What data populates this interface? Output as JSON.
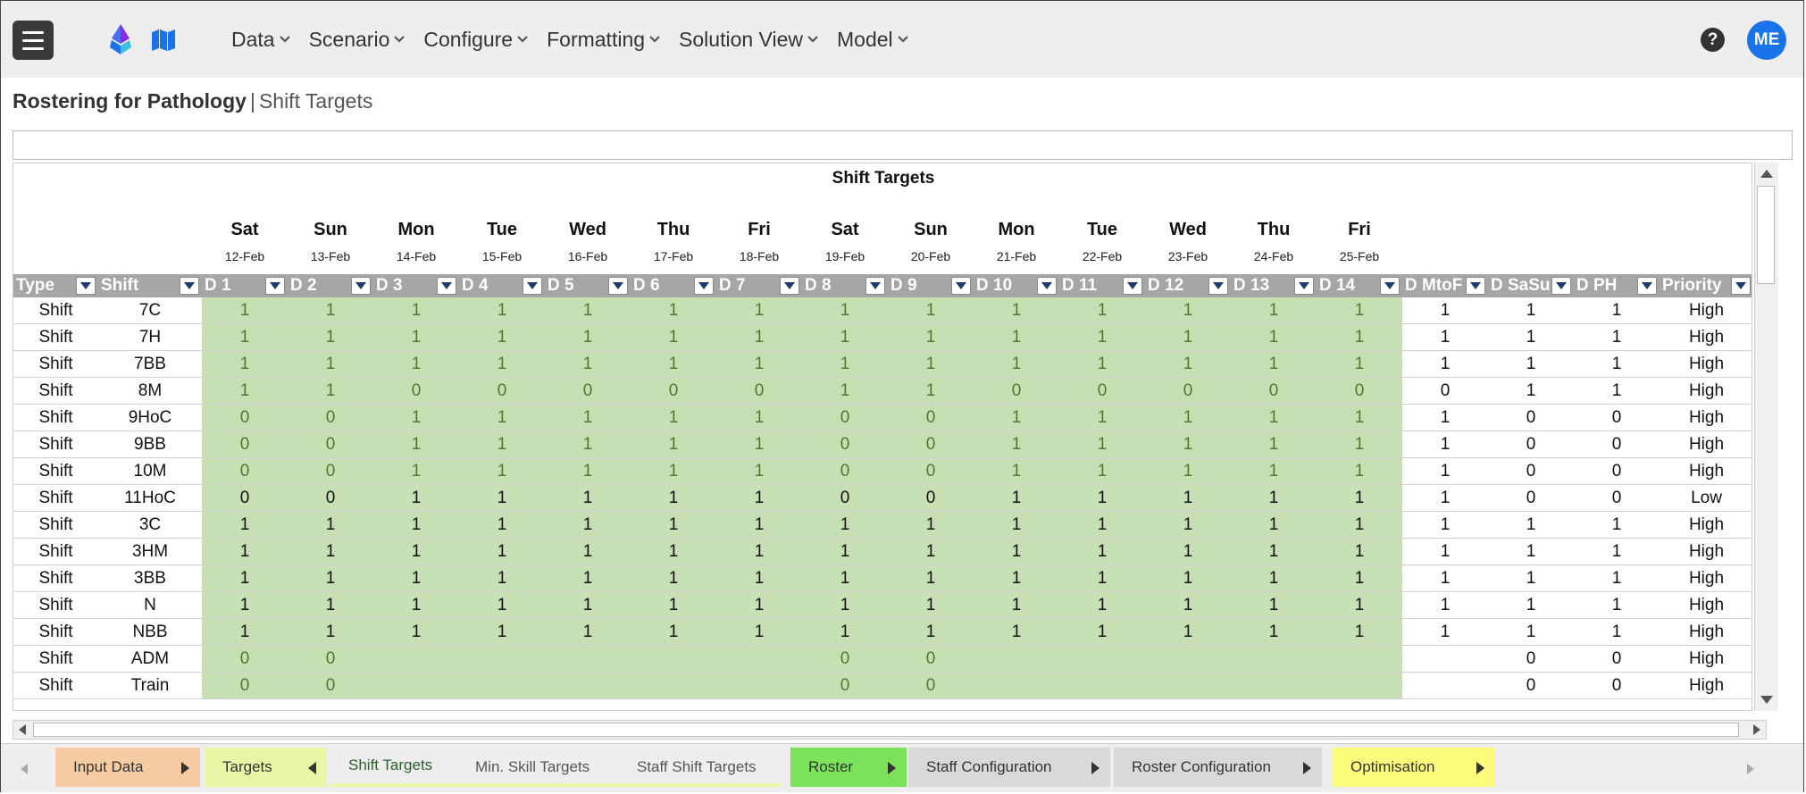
{
  "menu": [
    "Data",
    "Scenario",
    "Configure",
    "Formatting",
    "Solution View",
    "Model"
  ],
  "user_initials": "ME",
  "help_label": "?",
  "title": {
    "app": "Rostering for Pathology",
    "separator": "|",
    "page": "Shift Targets"
  },
  "sheet": {
    "title": "Shift Targets",
    "days": [
      {
        "day": "Sat",
        "date": "12-Feb"
      },
      {
        "day": "Sun",
        "date": "13-Feb"
      },
      {
        "day": "Mon",
        "date": "14-Feb"
      },
      {
        "day": "Tue",
        "date": "15-Feb"
      },
      {
        "day": "Wed",
        "date": "16-Feb"
      },
      {
        "day": "Thu",
        "date": "17-Feb"
      },
      {
        "day": "Fri",
        "date": "18-Feb"
      },
      {
        "day": "Sat",
        "date": "19-Feb"
      },
      {
        "day": "Sun",
        "date": "20-Feb"
      },
      {
        "day": "Mon",
        "date": "21-Feb"
      },
      {
        "day": "Tue",
        "date": "22-Feb"
      },
      {
        "day": "Wed",
        "date": "23-Feb"
      },
      {
        "day": "Thu",
        "date": "24-Feb"
      },
      {
        "day": "Fri",
        "date": "25-Feb"
      }
    ],
    "columns": [
      "Type",
      "Shift",
      "D 1",
      "D 2",
      "D 3",
      "D 4",
      "D 5",
      "D 6",
      "D 7",
      "D 8",
      "D 9",
      "D 10",
      "D 11",
      "D 12",
      "D 13",
      "D 14",
      "D MtoF",
      "D SaSu",
      "D PH",
      "Priority"
    ],
    "rows": [
      {
        "type": "Shift",
        "shift": "7C",
        "d": [
          "1",
          "1",
          "1",
          "1",
          "1",
          "1",
          "1",
          "1",
          "1",
          "1",
          "1",
          "1",
          "1",
          "1"
        ],
        "mtof": "1",
        "sasu": "1",
        "ph": "1",
        "priority": "High",
        "style": "g"
      },
      {
        "type": "Shift",
        "shift": "7H",
        "d": [
          "1",
          "1",
          "1",
          "1",
          "1",
          "1",
          "1",
          "1",
          "1",
          "1",
          "1",
          "1",
          "1",
          "1"
        ],
        "mtof": "1",
        "sasu": "1",
        "ph": "1",
        "priority": "High",
        "style": "g"
      },
      {
        "type": "Shift",
        "shift": "7BB",
        "d": [
          "1",
          "1",
          "1",
          "1",
          "1",
          "1",
          "1",
          "1",
          "1",
          "1",
          "1",
          "1",
          "1",
          "1"
        ],
        "mtof": "1",
        "sasu": "1",
        "ph": "1",
        "priority": "High",
        "style": "g"
      },
      {
        "type": "Shift",
        "shift": "8M",
        "d": [
          "1",
          "1",
          "0",
          "0",
          "0",
          "0",
          "0",
          "1",
          "1",
          "0",
          "0",
          "0",
          "0",
          "0"
        ],
        "mtof": "0",
        "sasu": "1",
        "ph": "1",
        "priority": "High",
        "style": "g"
      },
      {
        "type": "Shift",
        "shift": "9HoC",
        "d": [
          "0",
          "0",
          "1",
          "1",
          "1",
          "1",
          "1",
          "0",
          "0",
          "1",
          "1",
          "1",
          "1",
          "1"
        ],
        "mtof": "1",
        "sasu": "0",
        "ph": "0",
        "priority": "High",
        "style": "g"
      },
      {
        "type": "Shift",
        "shift": "9BB",
        "d": [
          "0",
          "0",
          "1",
          "1",
          "1",
          "1",
          "1",
          "0",
          "0",
          "1",
          "1",
          "1",
          "1",
          "1"
        ],
        "mtof": "1",
        "sasu": "0",
        "ph": "0",
        "priority": "High",
        "style": "g"
      },
      {
        "type": "Shift",
        "shift": "10M",
        "d": [
          "0",
          "0",
          "1",
          "1",
          "1",
          "1",
          "1",
          "0",
          "0",
          "1",
          "1",
          "1",
          "1",
          "1"
        ],
        "mtof": "1",
        "sasu": "0",
        "ph": "0",
        "priority": "High",
        "style": "g"
      },
      {
        "type": "Shift",
        "shift": "11HoC",
        "d": [
          "0",
          "0",
          "1",
          "1",
          "1",
          "1",
          "1",
          "0",
          "0",
          "1",
          "1",
          "1",
          "1",
          "1"
        ],
        "mtof": "1",
        "sasu": "0",
        "ph": "0",
        "priority": "Low",
        "style": "b"
      },
      {
        "type": "Shift",
        "shift": "3C",
        "d": [
          "1",
          "1",
          "1",
          "1",
          "1",
          "1",
          "1",
          "1",
          "1",
          "1",
          "1",
          "1",
          "1",
          "1"
        ],
        "mtof": "1",
        "sasu": "1",
        "ph": "1",
        "priority": "High",
        "style": "b"
      },
      {
        "type": "Shift",
        "shift": "3HM",
        "d": [
          "1",
          "1",
          "1",
          "1",
          "1",
          "1",
          "1",
          "1",
          "1",
          "1",
          "1",
          "1",
          "1",
          "1"
        ],
        "mtof": "1",
        "sasu": "1",
        "ph": "1",
        "priority": "High",
        "style": "b"
      },
      {
        "type": "Shift",
        "shift": "3BB",
        "d": [
          "1",
          "1",
          "1",
          "1",
          "1",
          "1",
          "1",
          "1",
          "1",
          "1",
          "1",
          "1",
          "1",
          "1"
        ],
        "mtof": "1",
        "sasu": "1",
        "ph": "1",
        "priority": "High",
        "style": "b"
      },
      {
        "type": "Shift",
        "shift": "N",
        "d": [
          "1",
          "1",
          "1",
          "1",
          "1",
          "1",
          "1",
          "1",
          "1",
          "1",
          "1",
          "1",
          "1",
          "1"
        ],
        "mtof": "1",
        "sasu": "1",
        "ph": "1",
        "priority": "High",
        "style": "b"
      },
      {
        "type": "Shift",
        "shift": "NBB",
        "d": [
          "1",
          "1",
          "1",
          "1",
          "1",
          "1",
          "1",
          "1",
          "1",
          "1",
          "1",
          "1",
          "1",
          "1"
        ],
        "mtof": "1",
        "sasu": "1",
        "ph": "1",
        "priority": "High",
        "style": "b"
      },
      {
        "type": "Shift",
        "shift": "ADM",
        "d": [
          "0",
          "0",
          "",
          "",
          "",
          "",
          "",
          "0",
          "0",
          "",
          "",
          "",
          "",
          ""
        ],
        "mtof": "",
        "sasu": "0",
        "ph": "0",
        "priority": "High",
        "style": "g"
      },
      {
        "type": "Shift",
        "shift": "Train",
        "d": [
          "0",
          "0",
          "",
          "",
          "",
          "",
          "",
          "0",
          "0",
          "",
          "",
          "",
          "",
          ""
        ],
        "mtof": "",
        "sasu": "0",
        "ph": "0",
        "priority": "High",
        "style": "g"
      }
    ]
  },
  "tabs": [
    {
      "label": "Input Data",
      "color": "#f8cba3",
      "arrow": "right"
    },
    {
      "label": "Targets",
      "color": "#eaf5a6",
      "arrow": "left"
    },
    {
      "label": "Shift Targets",
      "color": "#eeeeee",
      "active": true
    },
    {
      "label": "Min. Skill Targets",
      "color": "#eeeeee"
    },
    {
      "label": "Staff Shift Targets",
      "color": "#eeeeee"
    },
    {
      "label": "Roster",
      "color": "#7be35a",
      "arrow": "right"
    },
    {
      "label": "Staff Configuration",
      "color": "#d9d9d9",
      "arrow": "right"
    },
    {
      "label": "Roster Configuration",
      "color": "#d9d9d9",
      "arrow": "right"
    },
    {
      "label": "Optimisation",
      "color": "#fcfc7c",
      "arrow": "right"
    }
  ]
}
